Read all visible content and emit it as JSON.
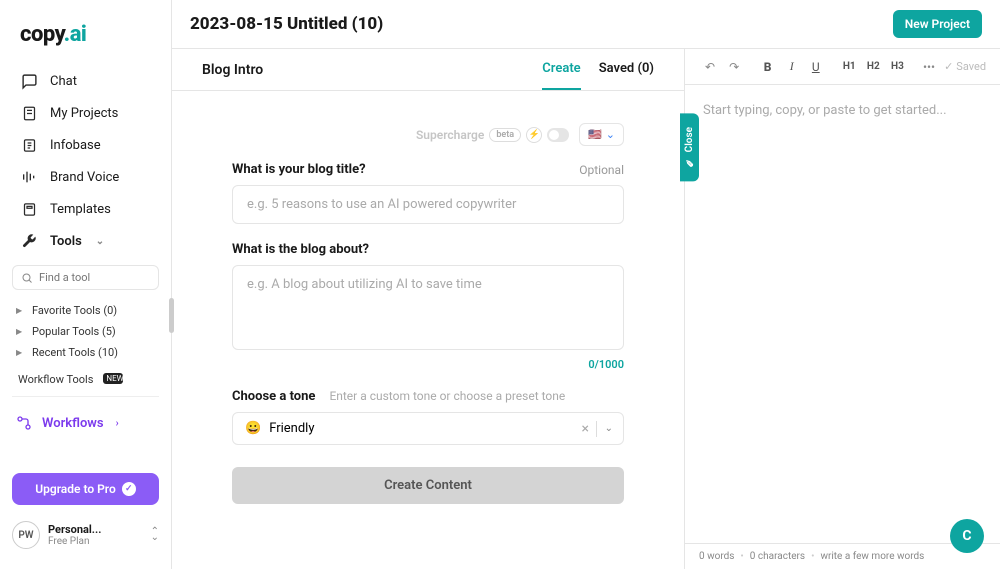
{
  "logo": {
    "brand": "copy",
    "suffix": ".ai"
  },
  "nav": {
    "chat": "Chat",
    "projects": "My Projects",
    "infobase": "Infobase",
    "brandvoice": "Brand Voice",
    "templates": "Templates",
    "tools": "Tools"
  },
  "search": {
    "placeholder": "Find a tool"
  },
  "toolGroups": {
    "favorite": "Favorite Tools (0)",
    "popular": "Popular Tools (5)",
    "recent": "Recent Tools (10)",
    "workflow": "Workflow Tools"
  },
  "workflows": "Workflows",
  "upgrade": "Upgrade to Pro",
  "account": {
    "initials": "PW",
    "name": "Personal...",
    "plan": "Free Plan"
  },
  "header": {
    "title": "2023-08-15 Untitled (10)",
    "newProject": "New Project"
  },
  "tool": {
    "name": "Blog Intro",
    "tabs": {
      "create": "Create",
      "saved": "Saved (0)"
    },
    "supercharge": "Supercharge",
    "beta": "beta",
    "flag": "🇺🇸",
    "close": "Close",
    "fields": {
      "titleLabel": "What is your blog title?",
      "optional": "Optional",
      "titlePlaceholder": "e.g. 5 reasons to use an AI powered copywriter",
      "aboutLabel": "What is the blog about?",
      "aboutPlaceholder": "e.g. A blog about utilizing AI to save time",
      "charcount": "0/1000",
      "toneLabel": "Choose a tone",
      "toneHint": "Enter a custom tone or choose a preset tone",
      "toneEmoji": "😀",
      "toneValue": "Friendly"
    },
    "cta": "Create Content"
  },
  "editor": {
    "saved": "Saved",
    "placeholder": "Start typing, copy, or paste to get started...",
    "footer": {
      "words": "0 words",
      "chars": "0 characters",
      "hint": "write a few more words"
    },
    "headings": {
      "h1": "H1",
      "h2": "H2",
      "h3": "H3"
    }
  },
  "fab": "C"
}
